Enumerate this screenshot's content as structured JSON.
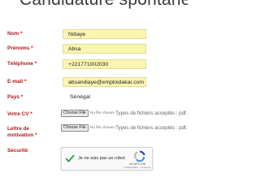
{
  "page": {
    "title": "Candidature spontanée"
  },
  "form": {
    "nom": {
      "label": "Nom *",
      "value": "Ndiaye"
    },
    "prenoms": {
      "label": "Prénoms *",
      "value": "Absa"
    },
    "telephone": {
      "label": "Téléphone *",
      "value": "+221771002030"
    },
    "email": {
      "label": "E-mail *",
      "value": "absandiaye@emploidakar.com"
    },
    "pays": {
      "label": "Pays *",
      "value": "Sénégal"
    },
    "cv": {
      "label": "Votre CV *",
      "button_label": "Choose File",
      "no_file_text": "No file chosen",
      "hint": "Types de fichiers acceptés : pdf."
    },
    "lettre": {
      "label_line1": "Lettre de",
      "label_line2": "motivation *",
      "button_label": "Choose File",
      "no_file_text": "No file chosen",
      "hint": "Types de fichiers acceptés : pdf."
    },
    "securite": {
      "label": "Sécurité",
      "captcha_text": "Je ne suis pas un robot",
      "captcha_checked": true,
      "captcha_brand": "reCAPTCHA",
      "captcha_links": "Confidentialité - Conditions"
    }
  },
  "colors": {
    "label": "#b01818",
    "field_background": "#fbf5b2",
    "check": "#1e9e4a"
  }
}
